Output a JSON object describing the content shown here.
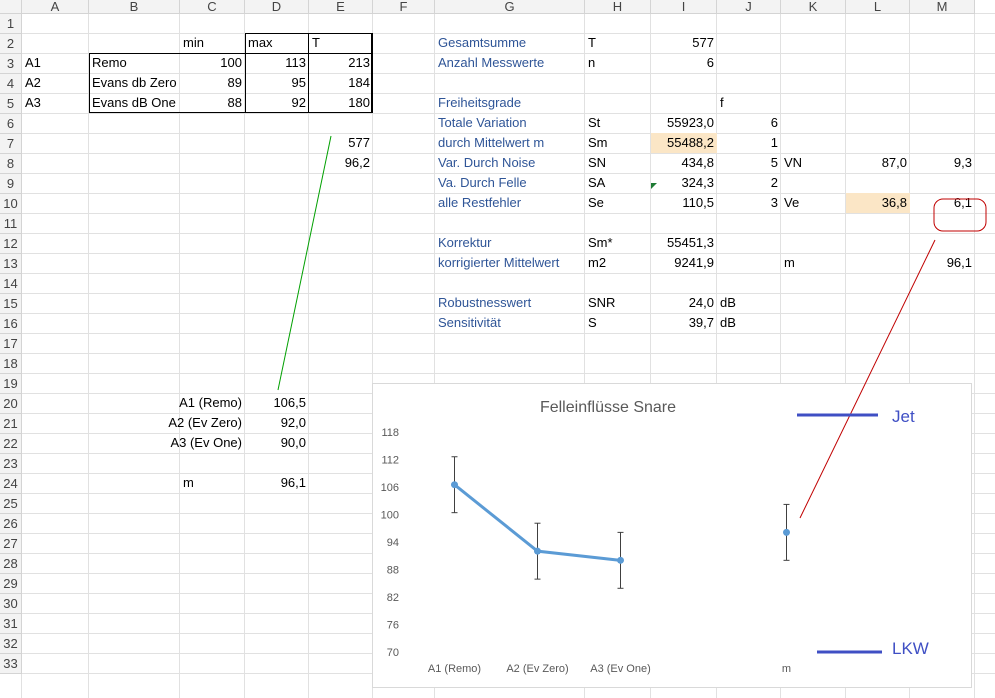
{
  "sheet": {
    "column_headers": [
      "A",
      "B",
      "C",
      "D",
      "E",
      "F",
      "G",
      "H",
      "I",
      "J",
      "K",
      "L",
      "M"
    ],
    "row_headers": [
      "1",
      "2",
      "3",
      "4",
      "5",
      "6",
      "7",
      "8",
      "9",
      "10",
      "11",
      "12",
      "13",
      "14",
      "15",
      "16",
      "17",
      "18",
      "19",
      "20",
      "21",
      "22",
      "23",
      "24",
      "25",
      "26",
      "27",
      "28",
      "29",
      "30",
      "31",
      "32",
      "33"
    ],
    "colors": {
      "label_blue": "#2f5597",
      "highlight": "#fbe6c6",
      "chart_line": "#5b9bd5",
      "annotation_red": "#c00000",
      "annotation_green": "#00a000",
      "marker_blue": "#3f4fc4"
    },
    "table": {
      "header": {
        "min": "min",
        "max": "max",
        "t": "T"
      },
      "rows": [
        {
          "code": "A1",
          "name": "Remo",
          "min": "100",
          "max": "113",
          "t": "213"
        },
        {
          "code": "A2",
          "name": "Evans db Zero",
          "min": "89",
          "max": "95",
          "t": "184"
        },
        {
          "code": "A3",
          "name": "Evans dB One",
          "min": "88",
          "max": "92",
          "t": "180"
        }
      ],
      "e7": "577",
      "e8": "96,2"
    },
    "averages": [
      {
        "label": "A1 (Remo)",
        "value": "106,5"
      },
      {
        "label": "A2 (Ev Zero)",
        "value": "92,0"
      },
      {
        "label": "A3 (Ev One)",
        "value": "90,0"
      }
    ],
    "mean_row": {
      "label": "m",
      "value": "96,1"
    },
    "stats": {
      "gesamtsumme": {
        "label": "Gesamtsumme",
        "sym": "T",
        "val": "577"
      },
      "anzahl": {
        "label": "Anzahl Messwerte",
        "sym": "n",
        "val": "6"
      },
      "freiheitsgrade": {
        "label": "Freiheitsgrade",
        "f": "f"
      },
      "rows": [
        {
          "label": "Totale Variation",
          "sym": "St",
          "val": "55923,0",
          "f": "6"
        },
        {
          "label": "durch Mittelwert m",
          "sym": "Sm",
          "val": "55488,2",
          "f": "1"
        },
        {
          "label": "Var. Durch Noise",
          "sym": "SN",
          "val": "434,8",
          "f": "5"
        },
        {
          "label": "Va. Durch Felle",
          "sym": "SA",
          "val": "324,3",
          "f": "2"
        },
        {
          "label": "alle Restfehler",
          "sym": "Se",
          "val": "110,5",
          "f": "3"
        }
      ],
      "vn": {
        "label": "VN",
        "l": "87,0",
        "m": "9,3"
      },
      "ve": {
        "label": "Ve",
        "l": "36,8",
        "m": "6,1"
      },
      "korrektur": {
        "label": "Korrektur",
        "sym": "Sm*",
        "val": "55451,3"
      },
      "korr_mittel": {
        "label": "korrigierter Mittelwert",
        "sym": "m2",
        "val": "9241,9",
        "k": "m",
        "m": "96,1"
      },
      "robust": {
        "label": "Robustnesswert",
        "sym": "SNR",
        "val": "24,0",
        "unit": "dB"
      },
      "sens": {
        "label": "Sensitivität",
        "sym": "S",
        "val": "39,7",
        "unit": "dB"
      }
    },
    "annotations": {
      "jet": "Jet",
      "lkw": "LKW"
    }
  },
  "chart_data": {
    "type": "line",
    "title": "Felleinflüsse Snare",
    "categories": [
      "A1 (Remo)",
      "A2 (Ev Zero)",
      "A3 (Ev One)",
      "",
      "m"
    ],
    "series": [
      {
        "values": [
          106.5,
          92.0,
          90.0,
          null,
          null
        ]
      }
    ],
    "extra_point": {
      "category": "m",
      "value": 96.1
    },
    "error_bars": [
      6.1,
      6.1,
      6.1,
      null,
      6.1
    ],
    "ylim": [
      70,
      118
    ],
    "yticks": [
      "118",
      "112",
      "106",
      "100",
      "94",
      "88",
      "82",
      "76",
      "70"
    ],
    "grid": false
  }
}
